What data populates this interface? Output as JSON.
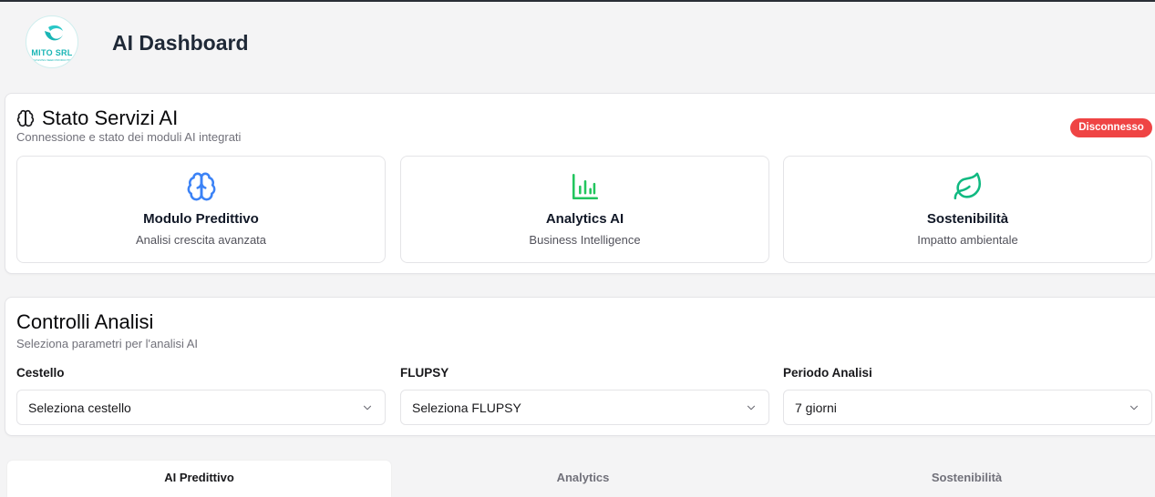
{
  "header": {
    "title": "AI Dashboard",
    "logo_text": "MITO SRL",
    "logo_tagline": "EVOLVING SEED PRODUCTION"
  },
  "status_card": {
    "title": "Stato Servizi AI",
    "description": "Connessione e stato dei moduli AI integrati",
    "badge": "Disconnesso",
    "badge_color": "#ef4444",
    "modules": [
      {
        "icon": "brain-icon",
        "title": "Modulo Predittivo",
        "subtitle": "Analisi crescita avanzata",
        "color": "#3b82f6"
      },
      {
        "icon": "bar-chart-icon",
        "title": "Analytics AI",
        "subtitle": "Business Intelligence",
        "color": "#22c55e"
      },
      {
        "icon": "leaf-icon",
        "title": "Sostenibilità",
        "subtitle": "Impatto ambientale",
        "color": "#10b981"
      }
    ]
  },
  "controls_card": {
    "title": "Controlli Analisi",
    "description": "Seleziona parametri per l'analisi AI",
    "fields": [
      {
        "label": "Cestello",
        "value": "Seleziona cestello"
      },
      {
        "label": "FLUPSY",
        "value": "Seleziona FLUPSY"
      },
      {
        "label": "Periodo Analisi",
        "value": "7 giorni"
      }
    ]
  },
  "tabs": [
    {
      "label": "AI Predittivo",
      "active": true
    },
    {
      "label": "Analytics",
      "active": false
    },
    {
      "label": "Sostenibilità",
      "active": false
    }
  ]
}
